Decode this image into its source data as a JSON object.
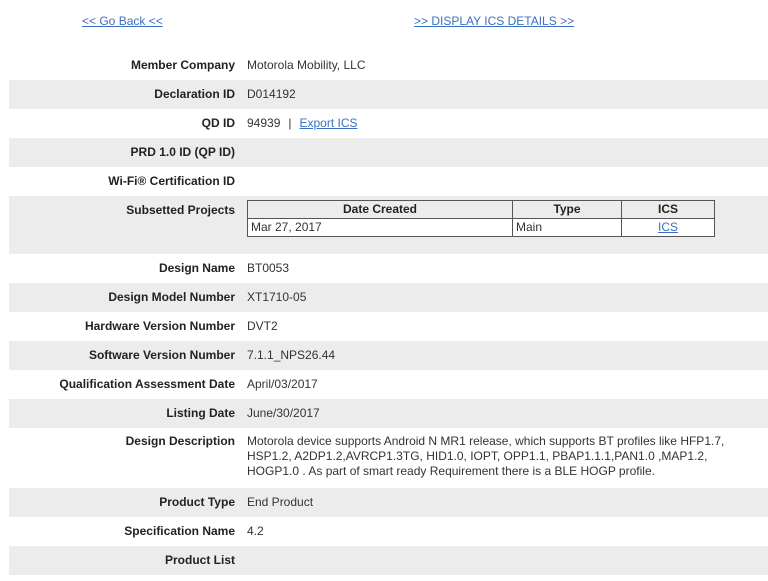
{
  "nav": {
    "back_label": "<< Go Back <<",
    "ics_label": ">> DISPLAY ICS DETAILS >>"
  },
  "details": {
    "member_company": {
      "label": "Member Company",
      "value": "Motorola Mobility, LLC"
    },
    "declaration_id": {
      "label": "Declaration ID",
      "value": "D014192"
    },
    "qd_id": {
      "label": "QD ID",
      "value": "94939",
      "separator": "|",
      "export_label": "Export ICS"
    },
    "prd_id": {
      "label": "PRD 1.0 ID (QP ID)",
      "value": ""
    },
    "wifi_cert": {
      "label": "Wi-Fi® Certification ID",
      "value": ""
    },
    "subsetted_projects": {
      "label": "Subsetted Projects",
      "columns": [
        "Date Created",
        "Type",
        "ICS"
      ],
      "rows": [
        {
          "date": "Mar 27, 2017",
          "type": "Main",
          "ics": "ICS"
        }
      ]
    },
    "design_name": {
      "label": "Design Name",
      "value": "BT0053"
    },
    "design_model_number": {
      "label": "Design Model Number",
      "value": "XT1710-05"
    },
    "hardware_version": {
      "label": "Hardware Version Number",
      "value": "DVT2"
    },
    "software_version": {
      "label": "Software Version Number",
      "value": "7.1.1_NPS26.44"
    },
    "qualification_date": {
      "label": "Qualification Assessment Date",
      "value": "April/03/2017"
    },
    "listing_date": {
      "label": "Listing Date",
      "value": "June/30/2017"
    },
    "design_description": {
      "label": "Design Description",
      "value": "Motorola device supports Android N MR1 release, which supports BT profiles like HFP1.7, HSP1.2, A2DP1.2,AVRCP1.3TG, HID1.0, IOPT, OPP1.1, PBAP1.1.1,PAN1.0 ,MAP1.2, HOGP1.0 . As part of smart ready Requirement there is a BLE HOGP profile."
    },
    "product_type": {
      "label": "Product Type",
      "value": "End Product"
    },
    "specification_name": {
      "label": "Specification Name",
      "value": "4.2"
    },
    "product_list": {
      "label": "Product List",
      "value": ""
    }
  }
}
